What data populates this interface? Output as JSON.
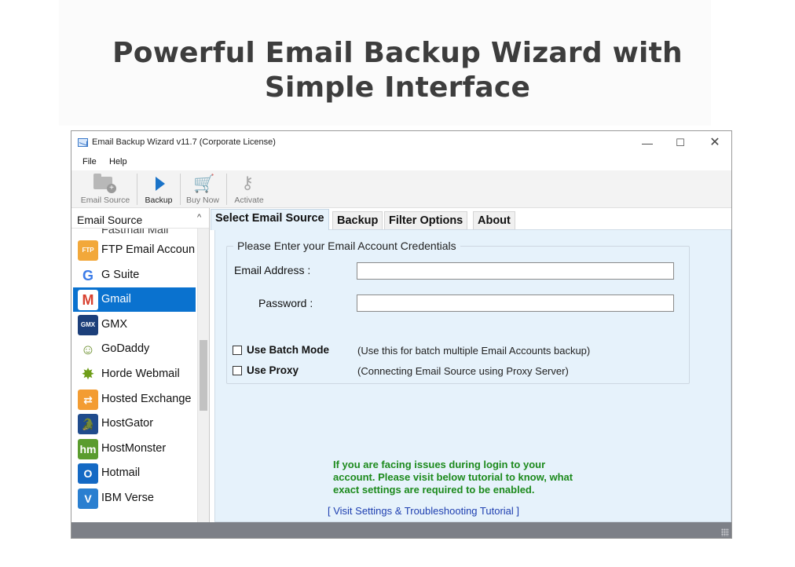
{
  "hero": {
    "title_line1": "Powerful Email Backup Wizard with",
    "title_line2": "Simple Interface"
  },
  "window": {
    "title": "Email Backup Wizard v11.7 (Corporate License)",
    "controls": {
      "minimize": "—",
      "maximize": "☐",
      "close": "✕"
    }
  },
  "menu": {
    "file": "File",
    "help": "Help"
  },
  "toolbar": {
    "email_source": "Email Source",
    "backup": "Backup",
    "buy_now": "Buy Now",
    "activate": "Activate"
  },
  "sidebar": {
    "title": "Email Source",
    "collapse_glyph": "^",
    "partial_item": "Fastmail Mail",
    "items": [
      {
        "label": "FTP Email Accoun",
        "icon": "ftp-icon",
        "glyph": "FTP",
        "color": "#f2a83a"
      },
      {
        "label": "G Suite",
        "icon": "google-icon",
        "glyph": "G",
        "color": "#ffffff"
      },
      {
        "label": "Gmail",
        "icon": "gmail-icon",
        "glyph": "M",
        "color": "#ffffff"
      },
      {
        "label": "GMX",
        "icon": "gmx-icon",
        "glyph": "GMX",
        "color": "#1c3f7a"
      },
      {
        "label": "GoDaddy",
        "icon": "godaddy-icon",
        "glyph": "☺",
        "color": "#ffffff"
      },
      {
        "label": "Horde Webmail",
        "icon": "horde-icon",
        "glyph": "✸",
        "color": "#ffffff"
      },
      {
        "label": "Hosted Exchange",
        "icon": "exchange-icon",
        "glyph": "⇄",
        "color": "#f39c32"
      },
      {
        "label": "HostGator",
        "icon": "hostgator-icon",
        "glyph": "🐊",
        "color": "#1f4b8c"
      },
      {
        "label": "HostMonster",
        "icon": "hostmonster-icon",
        "glyph": "hm",
        "color": "#5a9c2e"
      },
      {
        "label": "Hotmail",
        "icon": "hotmail-icon",
        "glyph": "O",
        "color": "#1469c4"
      },
      {
        "label": "IBM Verse",
        "icon": "ibm-verse-icon",
        "glyph": "V",
        "color": "#2a7fd0"
      }
    ],
    "selected_index": 2
  },
  "tabs": [
    {
      "label": "Select Email Source",
      "active": true
    },
    {
      "label": "Backup",
      "active": false
    },
    {
      "label": "Filter Options",
      "active": false
    },
    {
      "label": "About",
      "active": false
    }
  ],
  "form": {
    "legend": "Please Enter your Email Account Credentials",
    "email_label": "Email Address :",
    "email_value": "",
    "password_label": "Password :",
    "password_value": "",
    "batch_label": "Use Batch Mode",
    "batch_hint": "(Use this for batch multiple Email Accounts backup)",
    "proxy_label": "Use Proxy",
    "proxy_hint": "(Connecting Email Source using Proxy Server)"
  },
  "help": {
    "line1": "If you are facing issues during login to your",
    "line2": "account. Please visit below tutorial to know, what",
    "line3": "exact settings are required to be enabled.",
    "link": "[ Visit Settings & Troubleshooting Tutorial ]"
  }
}
